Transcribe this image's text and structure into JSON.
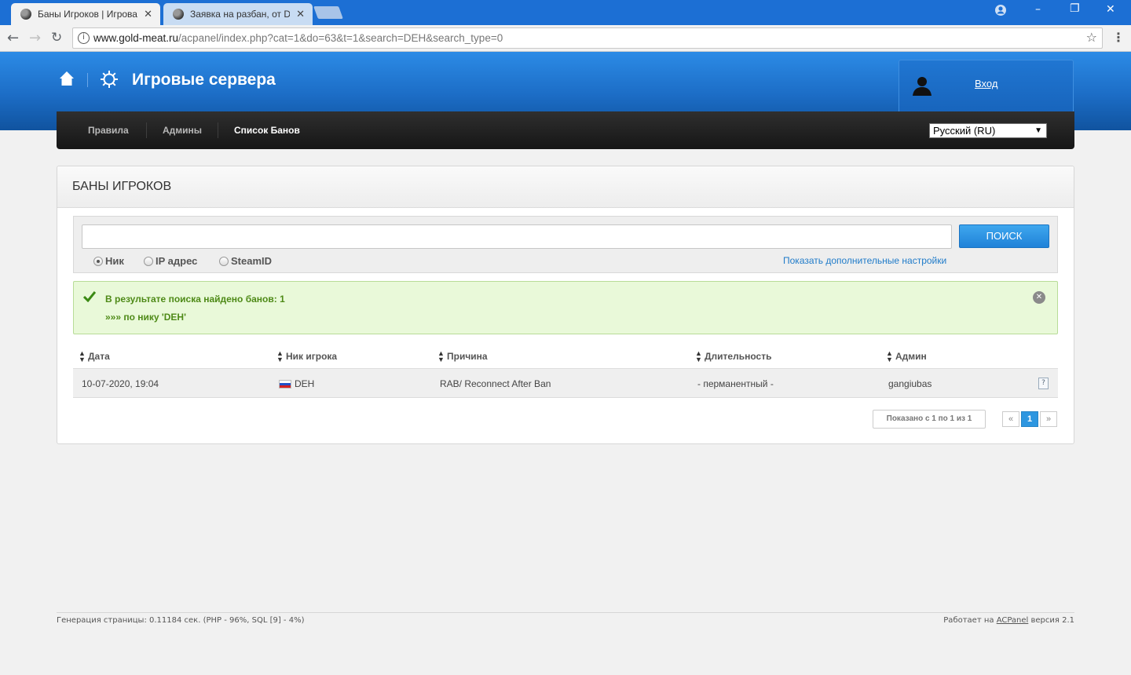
{
  "browser": {
    "tabs": [
      {
        "title": "Баны Игроков | Игрова",
        "active": true
      },
      {
        "title": "Заявка на разбан, от DE",
        "active": false
      }
    ],
    "url_host": "www.gold-meat.ru",
    "url_path": "/acpanel/index.php?cat=1&do=63&t=1&search=DEH&search_type=0"
  },
  "header": {
    "title": "Игровые сервера",
    "login_label": "Вход"
  },
  "nav": {
    "items": [
      {
        "label": "Правила"
      },
      {
        "label": "Админы"
      },
      {
        "label": "Список Банов"
      }
    ],
    "language": "Русский (RU)"
  },
  "panel": {
    "title": "БАНЫ ИГРОКОВ",
    "search": {
      "value": "",
      "button_label": "ПОИСК",
      "options": [
        {
          "label": "Ник",
          "checked": true
        },
        {
          "label": "IP адрес",
          "checked": false
        },
        {
          "label": "SteamID",
          "checked": false
        }
      ],
      "more_settings_label": "Показать дополнительные настройки"
    },
    "alert": {
      "line1": "В результате поиска найдено банов: 1",
      "line2": "»»» по нику 'DEH'"
    },
    "table": {
      "columns": [
        "Дата",
        "Ник игрока",
        "Причина",
        "Длительность",
        "Админ"
      ],
      "rows": [
        {
          "date": "10-07-2020, 19:04",
          "nick": "DEH",
          "reason": "RAB/ Reconnect After Ban",
          "duration": "- перманентный -",
          "admin": "gangiubas"
        }
      ]
    },
    "pagination": {
      "showing": "Показано с 1 по 1 из 1",
      "prev": "«",
      "current": "1",
      "next": "»"
    }
  },
  "footer": {
    "left": "Генерация страницы: 0.11184 сек. (PHP - 96%, SQL [9] - 4%)",
    "right_prefix": "Работает на",
    "right_link": "ACPanel",
    "right_suffix": "версия 2.1"
  },
  "colors": {
    "header_blue": "#1c6dc6",
    "nav_dark": "#1f1f1f",
    "button_blue": "#2d96e0",
    "success_green": "#4e8a17",
    "success_bg": "#e9f9d9"
  }
}
